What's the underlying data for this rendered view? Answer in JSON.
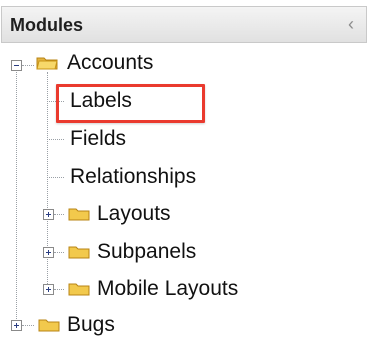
{
  "header": {
    "title": "Modules",
    "collapse_icon": "chevron-left-icon",
    "collapse_label": "‹"
  },
  "tree": {
    "items": [
      {
        "label": "Accounts"
      },
      {
        "label": "Labels"
      },
      {
        "label": "Fields"
      },
      {
        "label": "Relationships"
      },
      {
        "label": "Layouts"
      },
      {
        "label": "Subpanels"
      },
      {
        "label": "Mobile Layouts"
      },
      {
        "label": "Bugs"
      }
    ]
  },
  "theme": {
    "highlight": "#ea3a2e",
    "header_bg": "#e9e9e9",
    "tree_line": "#9aa0a6",
    "folder_yellow": "#f2c94c"
  }
}
